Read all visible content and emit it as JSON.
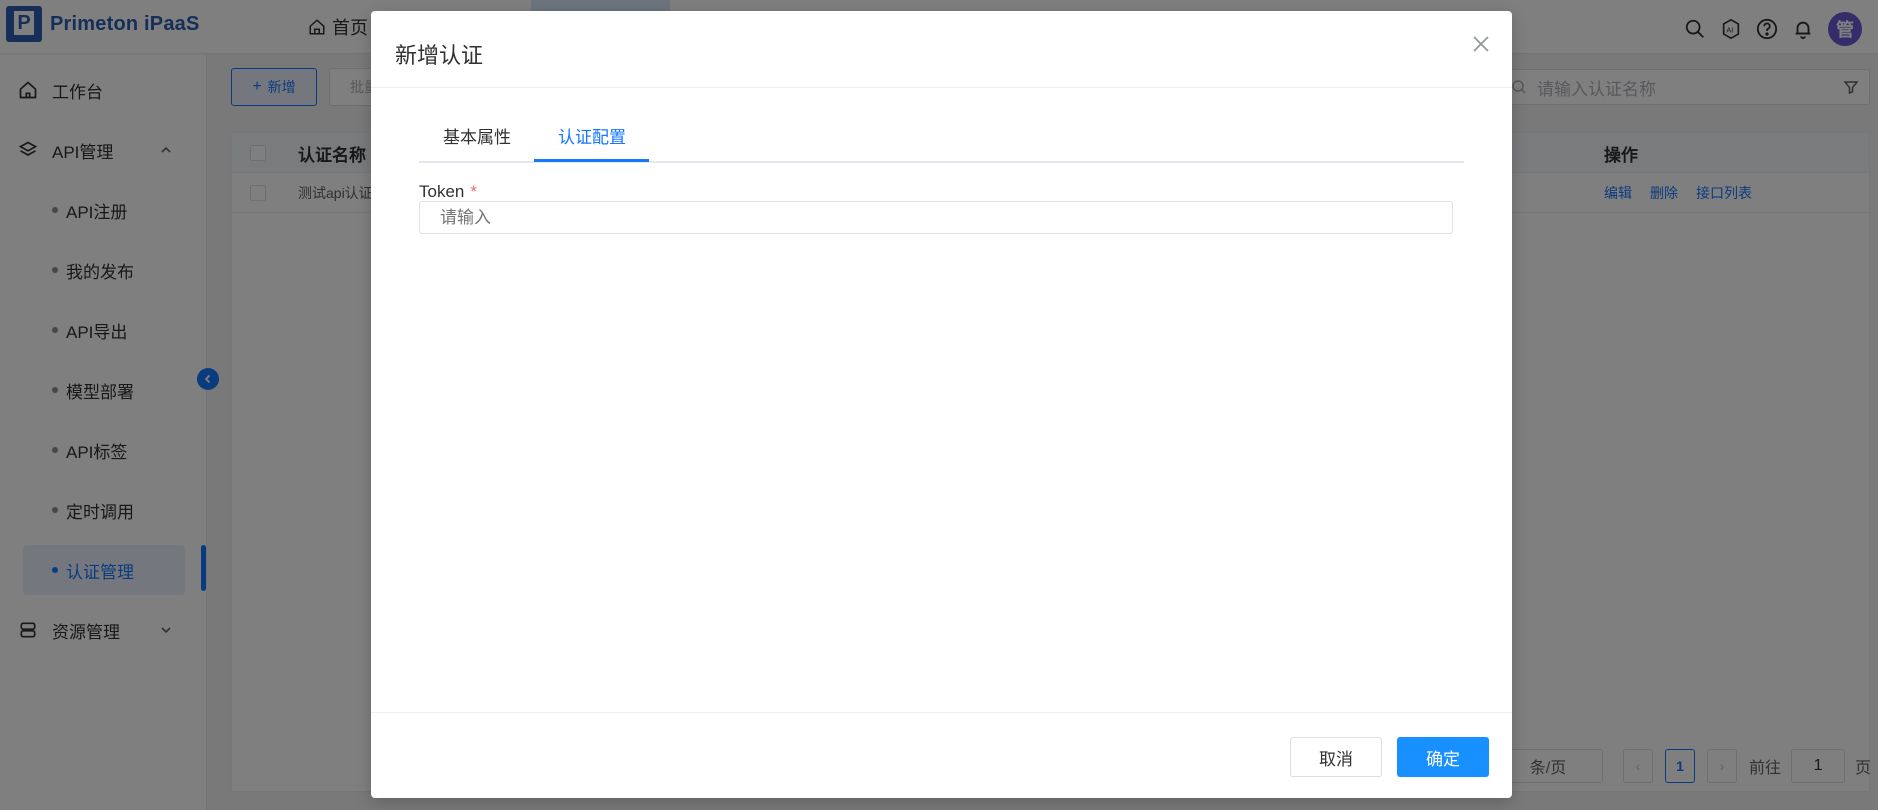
{
  "header": {
    "brand": "Primeton iPaaS",
    "home_nav": "首页",
    "avatar_text": "管",
    "icons": [
      "search-icon",
      "ai-icon",
      "help-icon",
      "bell-icon"
    ]
  },
  "sidebar": {
    "workbench": "工作台",
    "api_mgmt": "API管理",
    "sub_items": [
      "API注册",
      "我的发布",
      "API导出",
      "模型部署",
      "API标签",
      "定时调用",
      "认证管理"
    ],
    "active_item": "认证管理",
    "resource_mgmt": "资源管理"
  },
  "toolbar": {
    "add_label": "新增",
    "batch_label": "批量",
    "search_placeholder": "请输入认证名称"
  },
  "table": {
    "col_name": "认证名称",
    "col_ops": "操作",
    "rows": [
      {
        "name": "测试api认证",
        "ops": [
          "编辑",
          "删除",
          "接口列表"
        ]
      }
    ]
  },
  "pager": {
    "page_size_suffix": "条/页",
    "current_page": "1",
    "goto_label": "前往",
    "goto_value": "1",
    "page_unit": "页"
  },
  "dialog": {
    "title": "新增认证",
    "tabs": [
      {
        "label": "基本属性",
        "active": false
      },
      {
        "label": "认证配置",
        "active": true
      }
    ],
    "token_label": "Token",
    "required_mark": "*",
    "token_placeholder": "请输入",
    "cancel_label": "取消",
    "ok_label": "确定"
  },
  "colors": {
    "accent": "#1677ff",
    "primary_button": "#1890ff",
    "required": "#f56c6c",
    "mask": "rgba(0,0,0,0.5)"
  }
}
